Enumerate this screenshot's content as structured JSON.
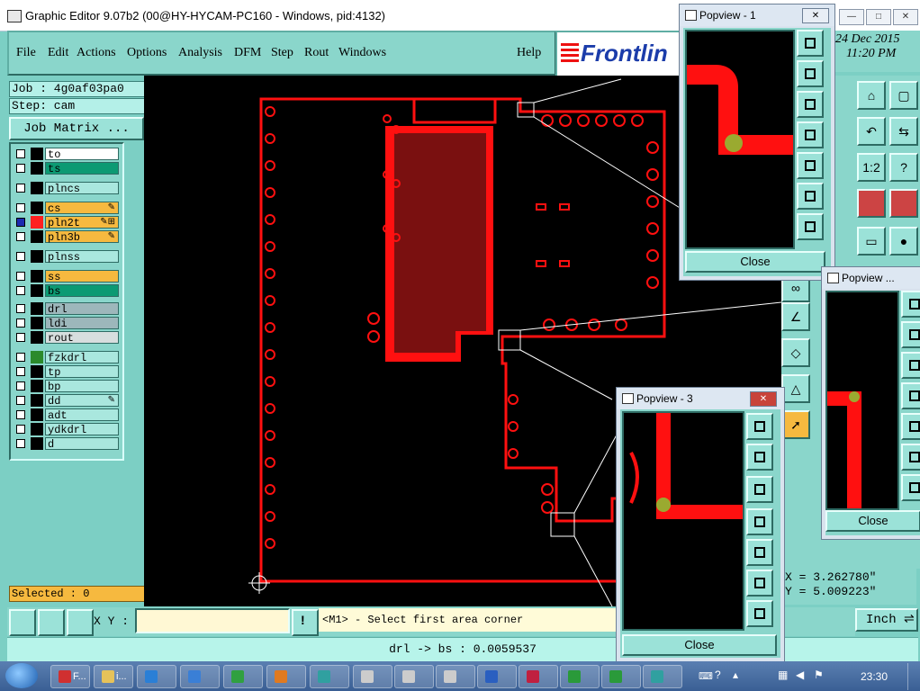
{
  "window": {
    "title": "Graphic Editor 9.07b2 (00@HY-HYCAM-PC160 - Windows, pid:4132)",
    "minimize": "—",
    "maximize": "□",
    "close": "✕"
  },
  "menu": {
    "items": [
      "File",
      "Edit",
      "Actions",
      "Options",
      "Analysis",
      "DFM",
      "Step",
      "Rout",
      "Windows"
    ],
    "help": "Help"
  },
  "logo": {
    "text": "Frontlin"
  },
  "job": {
    "job_label": "Job : 4g0af03pa0",
    "step_label": "Step: cam",
    "matrix_button": "Job Matrix ..."
  },
  "layers": [
    {
      "name": "to",
      "bg": "#ffffff",
      "swatch": "#000000",
      "checked": false,
      "icon": ""
    },
    {
      "name": "ts",
      "bg": "#0c9a73",
      "swatch": "#000000",
      "checked": false,
      "icon": ""
    },
    {
      "name": "plncs",
      "bg": "#a9e7de",
      "swatch": "#000000",
      "checked": false,
      "icon": ""
    },
    {
      "name": "cs",
      "bg": "#f6b93f",
      "swatch": "#000000",
      "checked": false,
      "icon": "✎"
    },
    {
      "name": "pln2t",
      "bg": "#f6b93f",
      "swatch": "#ff2020",
      "checked": true,
      "icon": "✎⊞"
    },
    {
      "name": "pln3b",
      "bg": "#f6b93f",
      "swatch": "#000000",
      "checked": false,
      "icon": "✎"
    },
    {
      "name": "plnss",
      "bg": "#a9e7de",
      "swatch": "#000000",
      "checked": false,
      "icon": ""
    },
    {
      "name": "ss",
      "bg": "#f6b93f",
      "swatch": "#000000",
      "checked": false,
      "icon": ""
    },
    {
      "name": "bs",
      "bg": "#0c9a73",
      "swatch": "#000000",
      "checked": false,
      "icon": ""
    },
    {
      "name": "drl",
      "bg": "#9db7bb",
      "swatch": "#000000",
      "checked": false,
      "icon": ""
    },
    {
      "name": "ldi",
      "bg": "#9db7bb",
      "swatch": "#000000",
      "checked": false,
      "icon": ""
    },
    {
      "name": "rout",
      "bg": "#d7dede",
      "swatch": "#000000",
      "checked": false,
      "icon": ""
    },
    {
      "name": "fzkdrl",
      "bg": "#a9e7de",
      "swatch": "#2b8a2b",
      "checked": false,
      "icon": ""
    },
    {
      "name": "tp",
      "bg": "#a9e7de",
      "swatch": "#000000",
      "checked": false,
      "icon": ""
    },
    {
      "name": "bp",
      "bg": "#a9e7de",
      "swatch": "#000000",
      "checked": false,
      "icon": ""
    },
    {
      "name": "dd",
      "bg": "#a9e7de",
      "swatch": "#000000",
      "checked": false,
      "icon": "✎"
    },
    {
      "name": "adt",
      "bg": "#a9e7de",
      "swatch": "#000000",
      "checked": false,
      "icon": ""
    },
    {
      "name": "ydkdrl",
      "bg": "#a9e7de",
      "swatch": "#000000",
      "checked": false,
      "icon": ""
    },
    {
      "name": "d",
      "bg": "#a9e7de",
      "swatch": "#000000",
      "checked": false,
      "icon": ""
    }
  ],
  "selected": "Selected : 0",
  "xy_label": "X Y :",
  "prompt": "<M1> - Select first area corner",
  "status": "drl -> bs : 0.0059537",
  "datetime": {
    "date": "24 Dec 2015",
    "time": "11:20 PM"
  },
  "coords": {
    "x": "X = 3.262780\"",
    "y": "Y = 5.009223\""
  },
  "units": "Inch",
  "popviews": [
    {
      "title": "Popview - 1",
      "close_label": "Close"
    },
    {
      "title": "Popview ...",
      "close_label": "Close"
    },
    {
      "title": "Popview - 3",
      "close_label": "Close"
    }
  ],
  "taskbar": {
    "items": [
      {
        "label": "F...",
        "color": "#d03030"
      },
      {
        "label": "i...",
        "color": "#e6c25a"
      },
      {
        "label": "",
        "color": "#2a7fd6"
      },
      {
        "label": "",
        "color": "#3a7fd6"
      },
      {
        "label": "",
        "color": "#30a040"
      },
      {
        "label": "",
        "color": "#e07a20"
      },
      {
        "label": "",
        "color": "#30a0a0"
      },
      {
        "label": "",
        "color": "#cccccc"
      },
      {
        "label": "",
        "color": "#cccccc"
      },
      {
        "label": "",
        "color": "#cccccc"
      },
      {
        "label": "",
        "color": "#2a5fc0"
      },
      {
        "label": "",
        "color": "#c02040"
      },
      {
        "label": "",
        "color": "#2a9a3a"
      },
      {
        "label": "",
        "color": "#2a9a3a"
      },
      {
        "label": "",
        "color": "#30a0a0"
      }
    ],
    "clock": "23:30"
  },
  "colors": {
    "accent": "#8ad6cb",
    "trace": "#ff1010",
    "canvas": "#000000"
  }
}
